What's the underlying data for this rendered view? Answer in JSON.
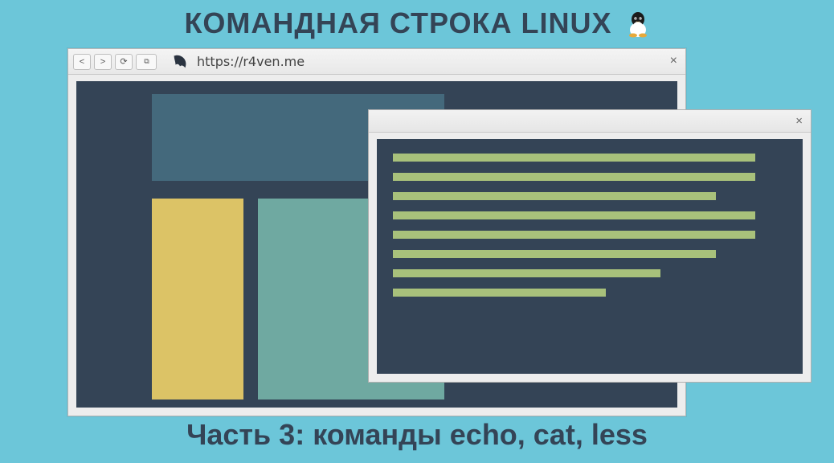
{
  "title": "КОМАНДНАЯ СТРОКА LINUX",
  "subtitle": "Часть 3: команды echo, cat, less",
  "browser": {
    "nav": {
      "back": "<",
      "forward": ">",
      "reload": "⟳",
      "tabs": "⧉"
    },
    "url": "https://r4ven.me",
    "close": "×",
    "layout": {
      "hero_color": "#44697c",
      "col_left_color": "#dcc366",
      "col_right_color": "#6fa9a1",
      "bg_color": "#344456"
    }
  },
  "terminal": {
    "close": "×",
    "bg_color": "#344456",
    "line_color": "#a8c17b",
    "line_widths_pct": [
      92,
      92,
      82,
      92,
      92,
      82,
      68,
      54
    ]
  },
  "colors": {
    "page_bg": "#6cc6d9",
    "text": "#344456"
  }
}
